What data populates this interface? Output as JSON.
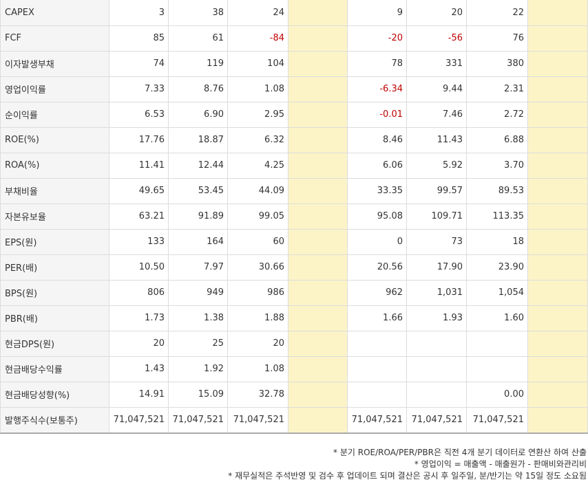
{
  "rows": [
    {
      "label": "CAPEX",
      "cells": [
        "3",
        "38",
        "24",
        "",
        "9",
        "20",
        "22",
        ""
      ],
      "neg": []
    },
    {
      "label": "FCF",
      "cells": [
        "85",
        "61",
        "-84",
        "",
        "-20",
        "-56",
        "76",
        ""
      ],
      "neg": [
        2,
        4,
        5
      ]
    },
    {
      "label": "이자발생부채",
      "cells": [
        "74",
        "119",
        "104",
        "",
        "78",
        "331",
        "380",
        ""
      ],
      "neg": []
    },
    {
      "label": "영업이익률",
      "cells": [
        "7.33",
        "8.76",
        "1.08",
        "",
        "-6.34",
        "9.44",
        "2.31",
        ""
      ],
      "neg": [
        4
      ]
    },
    {
      "label": "순이익률",
      "cells": [
        "6.53",
        "6.90",
        "2.95",
        "",
        "-0.01",
        "7.46",
        "2.72",
        ""
      ],
      "neg": [
        4
      ]
    },
    {
      "label": "ROE(%)",
      "cells": [
        "17.76",
        "18.87",
        "6.32",
        "",
        "8.46",
        "11.43",
        "6.88",
        ""
      ],
      "neg": []
    },
    {
      "label": "ROA(%)",
      "cells": [
        "11.41",
        "12.44",
        "4.25",
        "",
        "6.06",
        "5.92",
        "3.70",
        ""
      ],
      "neg": []
    },
    {
      "label": "부채비율",
      "cells": [
        "49.65",
        "53.45",
        "44.09",
        "",
        "33.35",
        "99.57",
        "89.53",
        ""
      ],
      "neg": []
    },
    {
      "label": "자본유보율",
      "cells": [
        "63.21",
        "91.89",
        "99.05",
        "",
        "95.08",
        "109.71",
        "113.35",
        ""
      ],
      "neg": []
    },
    {
      "label": "EPS(원)",
      "cells": [
        "133",
        "164",
        "60",
        "",
        "0",
        "73",
        "18",
        ""
      ],
      "neg": []
    },
    {
      "label": "PER(배)",
      "cells": [
        "10.50",
        "7.97",
        "30.66",
        "",
        "20.56",
        "17.90",
        "23.90",
        ""
      ],
      "neg": []
    },
    {
      "label": "BPS(원)",
      "cells": [
        "806",
        "949",
        "986",
        "",
        "962",
        "1,031",
        "1,054",
        ""
      ],
      "neg": []
    },
    {
      "label": "PBR(배)",
      "cells": [
        "1.73",
        "1.38",
        "1.88",
        "",
        "1.66",
        "1.93",
        "1.60",
        ""
      ],
      "neg": []
    },
    {
      "label": "현금DPS(원)",
      "cells": [
        "20",
        "25",
        "20",
        "",
        "",
        "",
        "",
        ""
      ],
      "neg": []
    },
    {
      "label": "현금배당수익률",
      "cells": [
        "1.43",
        "1.92",
        "1.08",
        "",
        "",
        "",
        "",
        ""
      ],
      "neg": []
    },
    {
      "label": "현금배당성향(%)",
      "cells": [
        "14.91",
        "15.09",
        "32.78",
        "",
        "",
        "",
        "0.00",
        ""
      ],
      "neg": []
    },
    {
      "label": "발행주식수(보통주)",
      "cells": [
        "71,047,521",
        "71,047,521",
        "71,047,521",
        "",
        "71,047,521",
        "71,047,521",
        "71,047,521",
        ""
      ],
      "neg": []
    }
  ],
  "highlight_color": "#fcf4c7",
  "negative_color": "#c00000",
  "notes": [
    "* 분기 ROE/ROA/PER/PBR은 직전 4개 분기 데이터로 연환산 하여 산출",
    "* 영업이익 = 매출액 - 매출원가 - 판매비와관리비",
    "* 재무실적은 주석반영 및 검수 후 업데이트 되며 결산은 공시 후 일주일, 분/반기는 약 15일 정도 소요됨"
  ]
}
